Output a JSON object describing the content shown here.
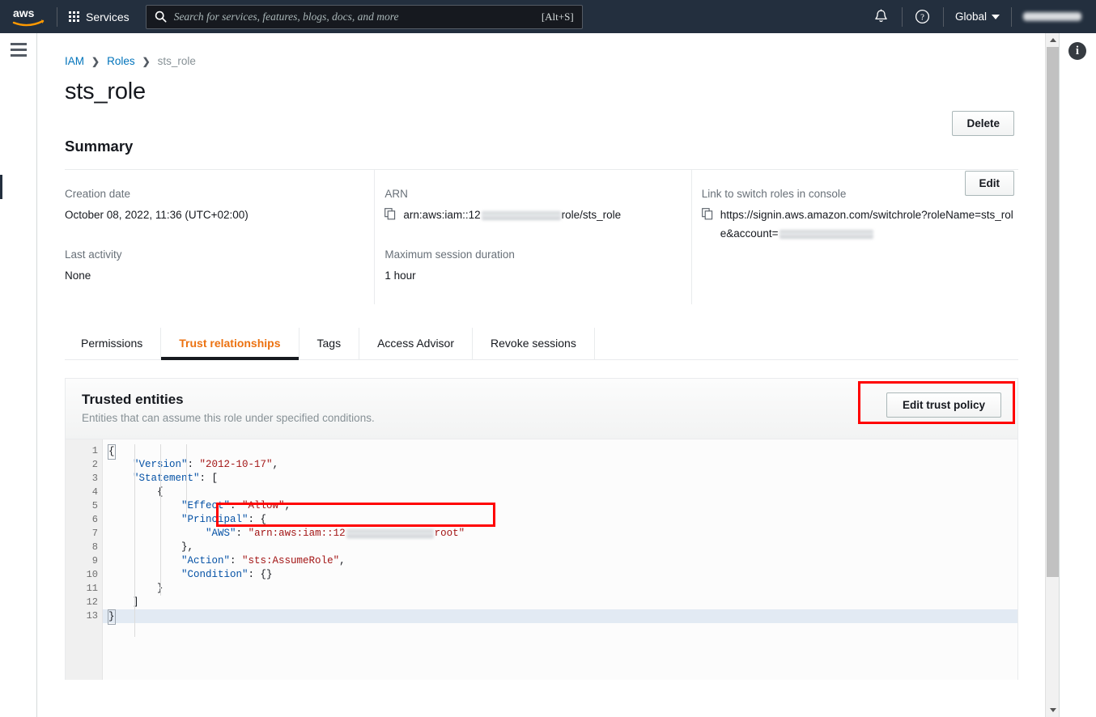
{
  "topnav": {
    "logo_alt": "aws",
    "services_label": "Services",
    "search_placeholder": "Search for services, features, blogs, docs, and more",
    "search_shortcut": "[Alt+S]",
    "bell_icon": "notifications-bell-icon",
    "help_icon": "help-question-icon",
    "region_label": "Global",
    "account_label": ""
  },
  "breadcrumb": {
    "items": [
      {
        "label": "IAM",
        "link": true
      },
      {
        "label": "Roles",
        "link": true
      },
      {
        "label": "sts_role",
        "link": false
      }
    ],
    "separator": "›"
  },
  "page": {
    "title": "sts_role",
    "delete_label": "Delete"
  },
  "summary": {
    "heading": "Summary",
    "edit_label": "Edit",
    "fields": {
      "creation_date_label": "Creation date",
      "creation_date_value": "October 08, 2022, 11:36 (UTC+02:00)",
      "last_activity_label": "Last activity",
      "last_activity_value": "None",
      "arn_label": "ARN",
      "arn_prefix": "arn:aws:iam::12",
      "arn_suffix": "role/sts_role",
      "max_session_label": "Maximum session duration",
      "max_session_value": "1 hour",
      "switch_link_label": "Link to switch roles in console",
      "switch_link_prefix": "https://signin.aws.amazon.com/switchrole?roleName=sts_role&account=",
      "copy_icon": "copy-icon"
    }
  },
  "tabs": [
    {
      "label": "Permissions",
      "active": false
    },
    {
      "label": "Trust relationships",
      "active": true
    },
    {
      "label": "Tags",
      "active": false
    },
    {
      "label": "Access Advisor",
      "active": false
    },
    {
      "label": "Revoke sessions",
      "active": false
    }
  ],
  "trusted_entities": {
    "title": "Trusted entities",
    "subtitle": "Entities that can assume this role under specified conditions.",
    "edit_trust_policy_label": "Edit trust policy"
  },
  "policy_editor": {
    "active_line": 13,
    "line_numbers": [
      "1",
      "2",
      "3",
      "4",
      "5",
      "6",
      "7",
      "8",
      "9",
      "10",
      "11",
      "12",
      "13"
    ],
    "fold_lines": [
      1,
      3,
      4,
      6
    ],
    "lines": [
      "{",
      "    \"Version\": \"2012-10-17\",",
      "    \"Statement\": [",
      "        {",
      "            \"Effect\": \"Allow\",",
      "            \"Principal\": {",
      "                \"AWS\": \"arn:aws:iam::12          root\"",
      "            },",
      "            \"Action\": \"sts:AssumeRole\",",
      "            \"Condition\": {}",
      "        }",
      "    ]",
      "}"
    ],
    "json_keys": [
      "Version",
      "Statement",
      "Effect",
      "Principal",
      "AWS",
      "Action",
      "Condition"
    ],
    "json_values": [
      "2012-10-17",
      "Allow",
      "arn:aws:iam::12...root",
      "sts:AssumeRole"
    ]
  },
  "annotations": [
    {
      "name": "edit-trust-policy-highlight",
      "color": "#ff0000"
    },
    {
      "name": "aws-principal-line-highlight",
      "color": "#ff0000"
    }
  ],
  "scrollbar": {
    "up_arrow": "scroll-up-arrow-icon",
    "down_arrow": "scroll-down-arrow-icon"
  },
  "right_rail": {
    "info_icon": "info-icon"
  }
}
